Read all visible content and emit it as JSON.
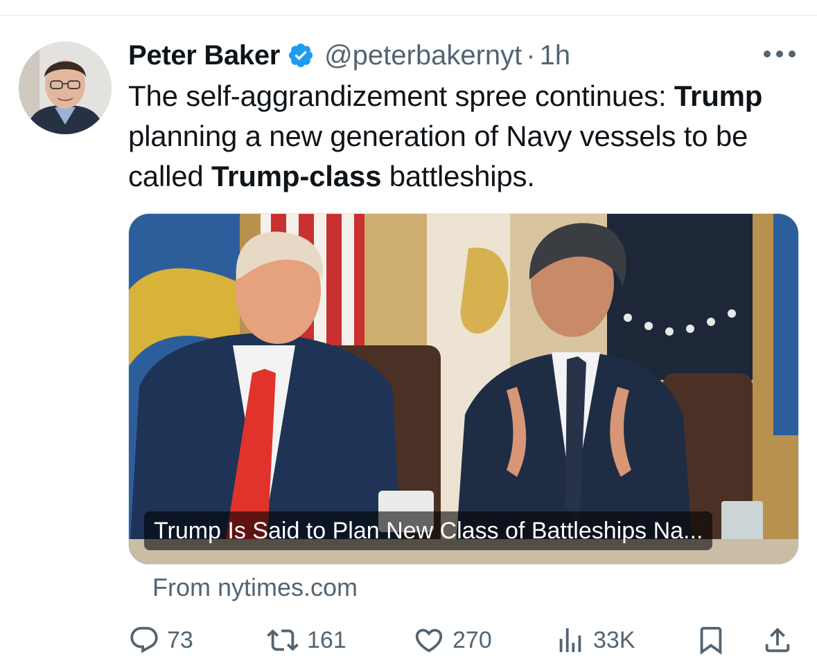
{
  "tweet": {
    "author_name": "Peter Baker",
    "handle": "@peterbakernyt",
    "separator": "·",
    "time": "1h",
    "text": {
      "part1": "The self-aggrandizement spree continues: ",
      "bold1": "Trump",
      "part2": " planning a new generation of Navy vessels to be called ",
      "bold2": "Trump-class",
      "part3": " battleships."
    }
  },
  "card": {
    "title": "Trump Is Said to Plan New Class of Battleships Na...",
    "source": "From nytimes.com"
  },
  "actions": {
    "replies": "73",
    "reposts": "161",
    "likes": "270",
    "views": "33K"
  },
  "colors": {
    "verified": "#1d9bf0",
    "muted": "#536471",
    "text": "#0f1419"
  },
  "icons": [
    "verified-badge-icon",
    "more-icon",
    "reply-icon",
    "repost-icon",
    "like-icon",
    "views-icon",
    "bookmark-icon",
    "share-icon"
  ]
}
